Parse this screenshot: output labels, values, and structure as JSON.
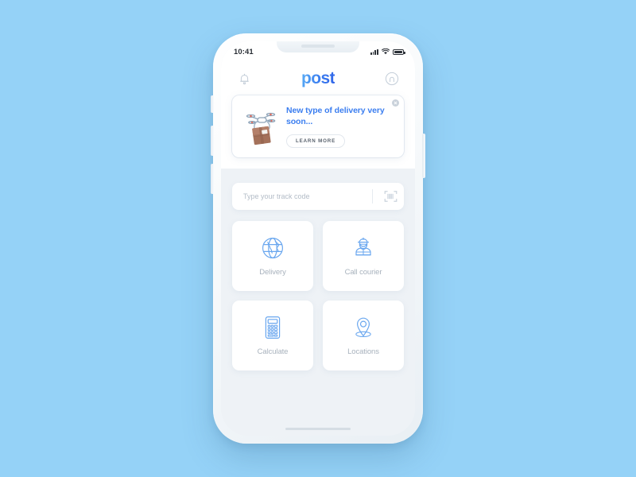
{
  "device": {
    "status_bar": {
      "time": "10:41",
      "signal_icon": "signal-bars-icon",
      "wifi_icon": "wifi-icon",
      "battery_icon": "battery-icon"
    },
    "home_indicator": "home-indicator"
  },
  "header": {
    "logo": "post",
    "bell_icon": "bell-icon",
    "profile_icon": "profile-avatar-icon"
  },
  "promo": {
    "title": "New type of delivery very soon...",
    "cta_label": "LEARN MORE",
    "close_icon": "close-icon",
    "art_icon": "drone-package-icon"
  },
  "search": {
    "placeholder": "Type your track code",
    "value": "",
    "scan_icon": "barcode-scan-icon"
  },
  "tiles": [
    {
      "label": "Delivery",
      "icon": "globe-icon"
    },
    {
      "label": "Call courier",
      "icon": "courier-person-icon"
    },
    {
      "label": "Calculate",
      "icon": "calculator-icon"
    },
    {
      "label": "Locations",
      "icon": "map-pin-icon"
    }
  ],
  "colors": {
    "background": "#95d2f7",
    "accent_blue": "#3b7ef0",
    "icon_blue": "#6aa7ef",
    "label_grey": "#a8b2bd",
    "screen_grey": "#eef2f6"
  }
}
